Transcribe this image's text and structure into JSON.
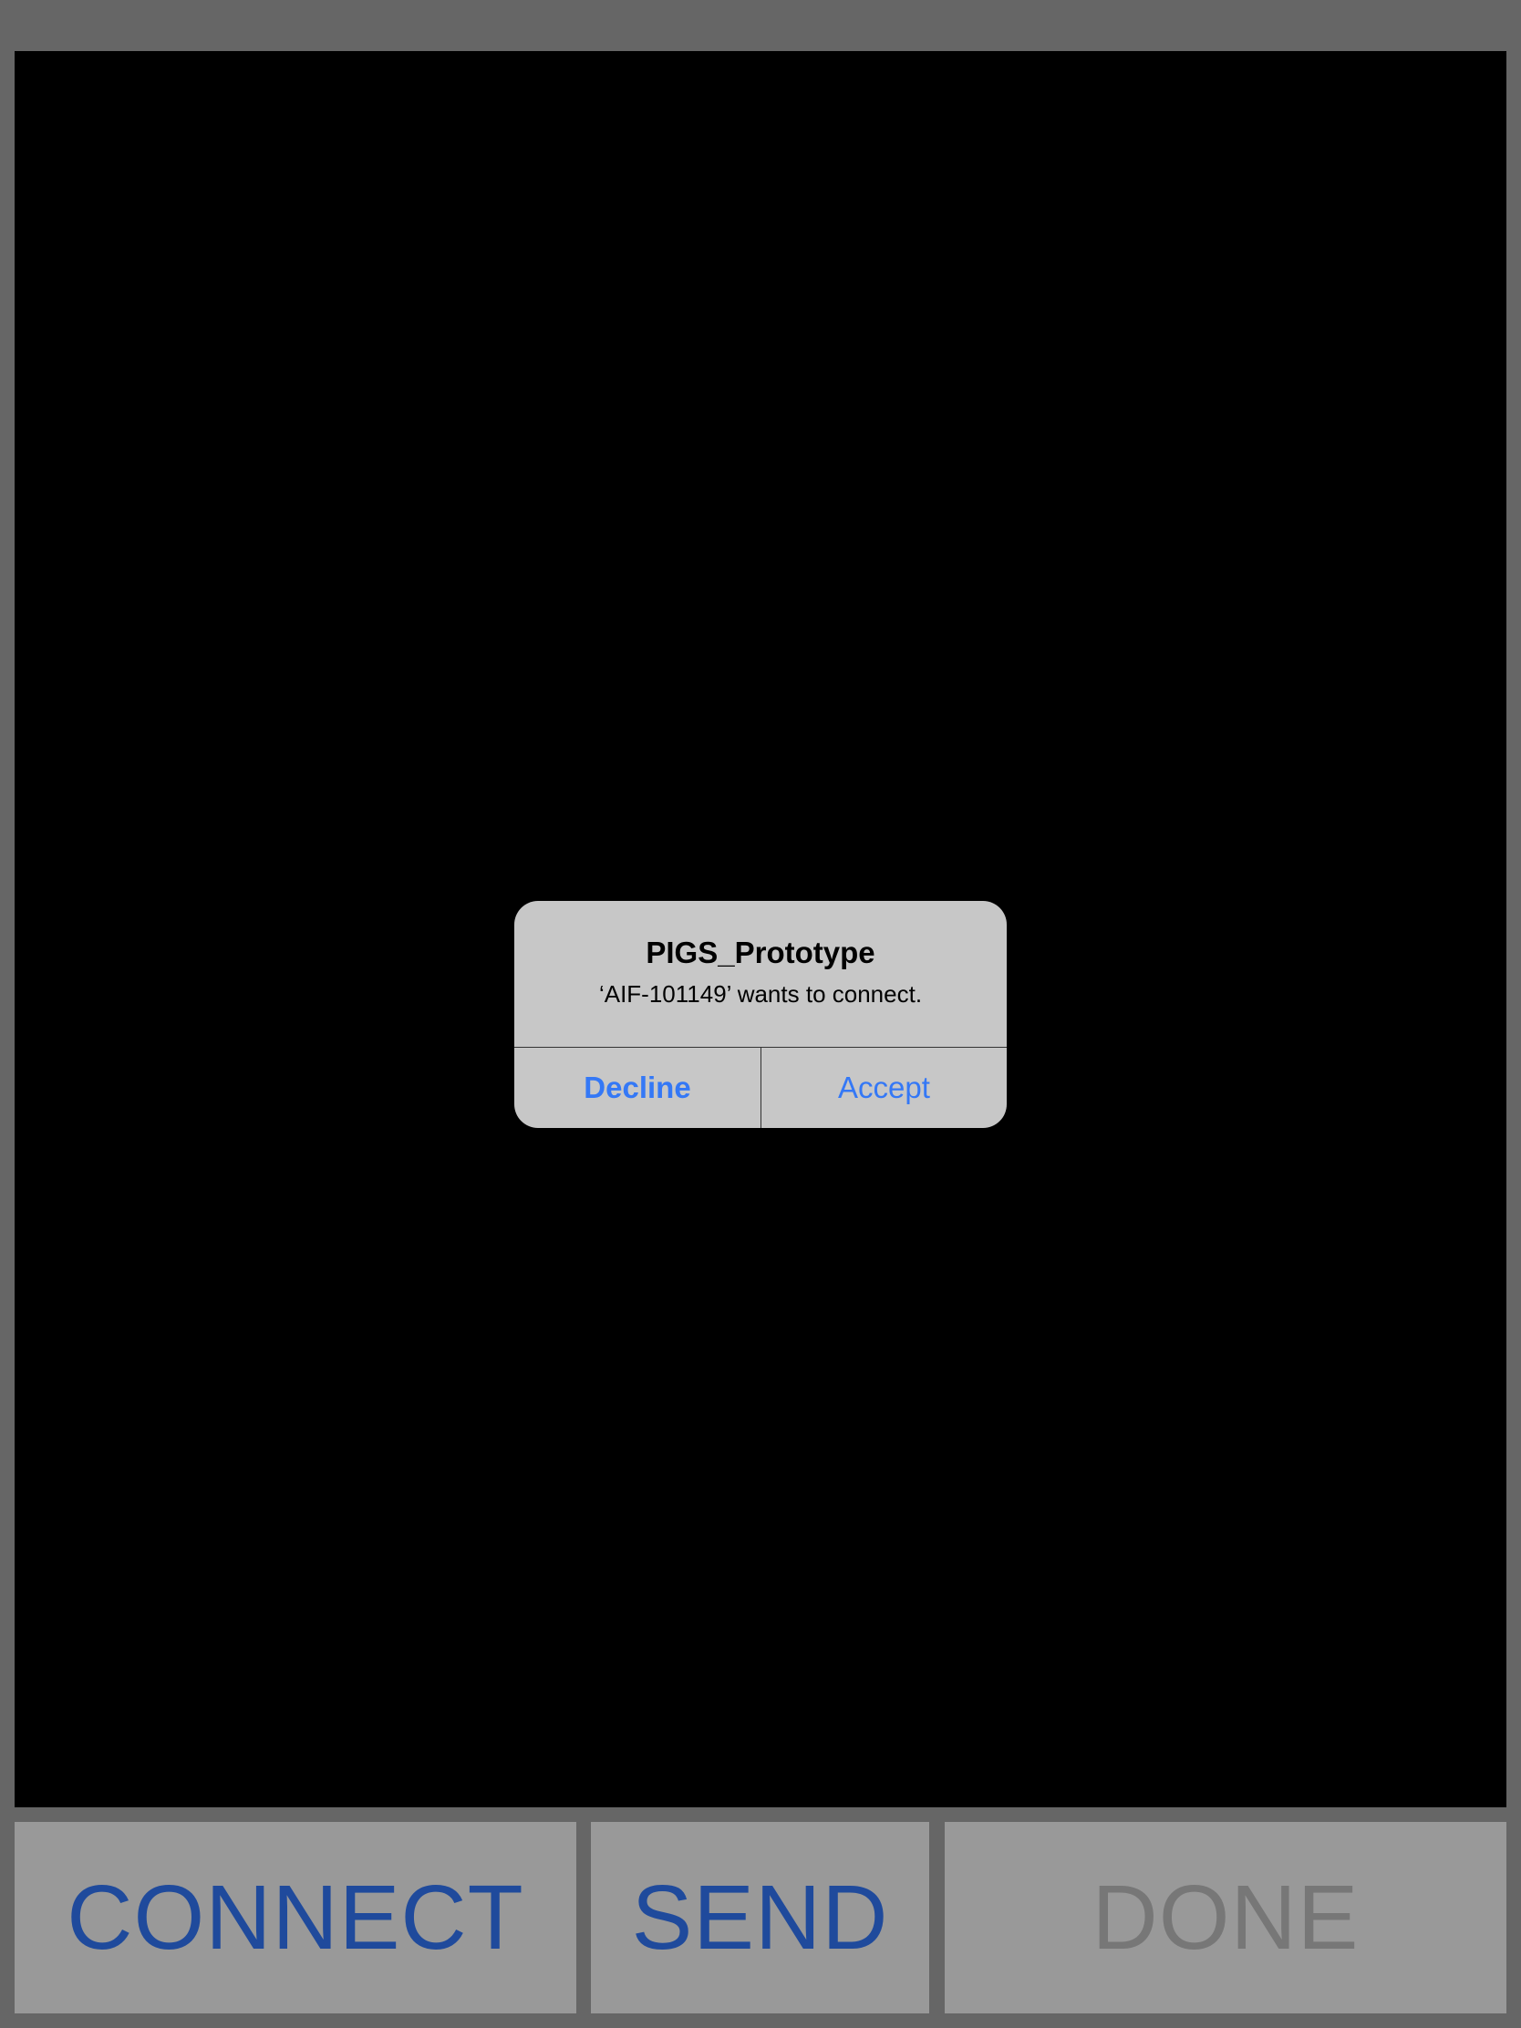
{
  "colors": {
    "background": "#666666",
    "canvas": "#000000",
    "alert_background": "#c7c7c7",
    "alert_button_text": "#3478f6",
    "bottom_button_background": "#999999",
    "bottom_button_enabled_text": "#1f4a9c",
    "bottom_button_disabled_text": "#777777"
  },
  "alert": {
    "title": "PIGS_Prototype",
    "message": "‘AIF-101149’ wants to connect.",
    "decline_label": "Decline",
    "accept_label": "Accept"
  },
  "toolbar": {
    "connect_label": "CONNECT",
    "send_label": "SEND",
    "done_label": "DONE",
    "connect_enabled": true,
    "send_enabled": true,
    "done_enabled": false
  }
}
